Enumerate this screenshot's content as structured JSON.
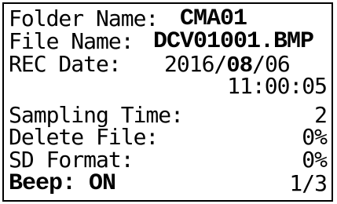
{
  "folder_name": {
    "label": "Folder Name:",
    "value": "CMA01"
  },
  "file_name": {
    "label": "File Name:",
    "value": "DCV01001.BMP"
  },
  "rec_date": {
    "label": "REC Date:",
    "date_prefix": "2016/",
    "date_month": "08",
    "date_suffix": "/06",
    "time": "11:00:05"
  },
  "sampling_time": {
    "label": "Sampling Time:",
    "value": "2"
  },
  "delete_file": {
    "label": "Delete File:",
    "value": "0%"
  },
  "sd_format": {
    "label": "SD   Format:",
    "value": "0%"
  },
  "beep": {
    "label": "Beep: ON"
  },
  "page_indicator": "1/3"
}
